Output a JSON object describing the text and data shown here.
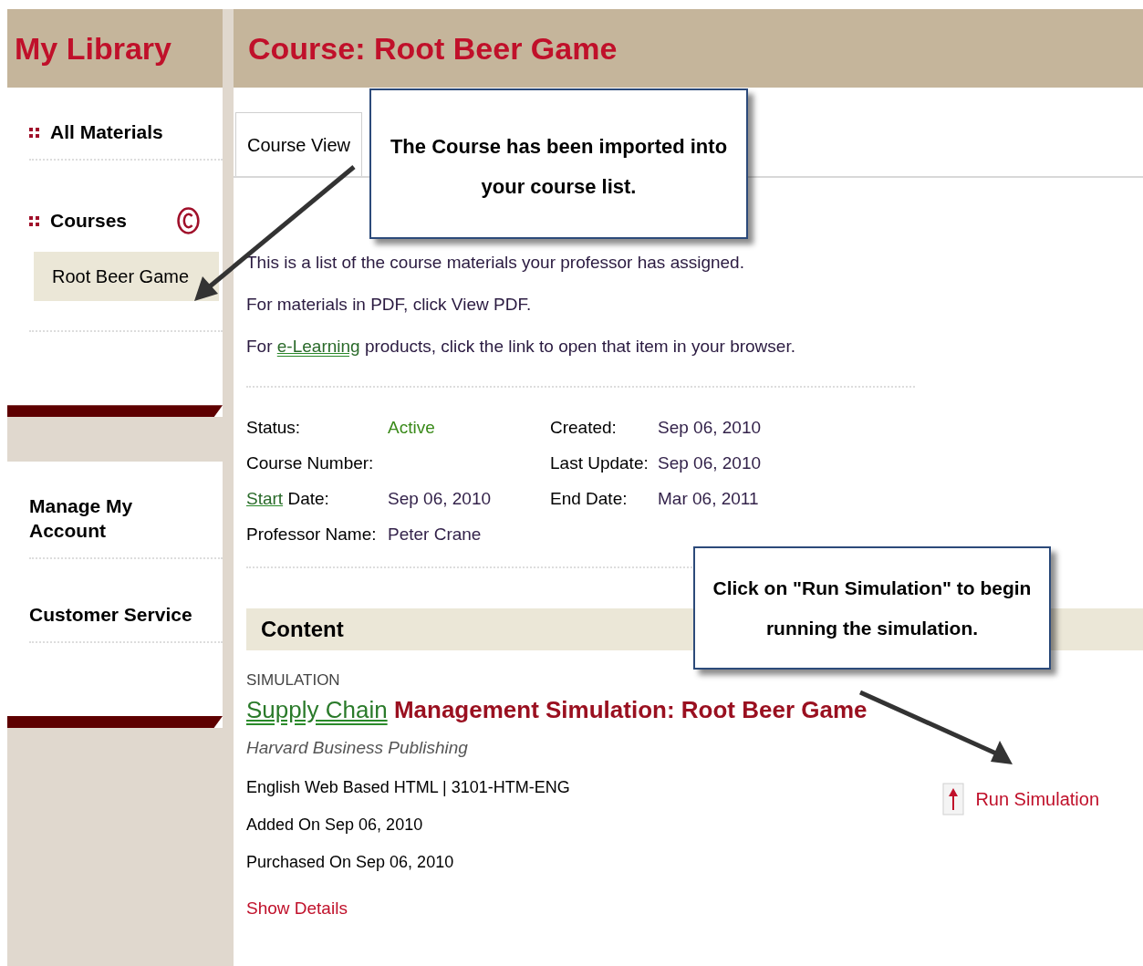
{
  "sidebar": {
    "title": "My Library",
    "blocks": [
      {
        "items": [
          {
            "label": "All Materials"
          },
          {
            "label": "Courses",
            "children": [
              {
                "label": "Root Beer Game",
                "selected": true
              }
            ]
          }
        ]
      },
      {
        "items": [
          {
            "label": "Manage My Account"
          },
          {
            "label": "Customer Service"
          }
        ]
      }
    ]
  },
  "main": {
    "title": "Course: Root Beer Game",
    "tabs": [
      {
        "label": "Course View",
        "selected": true
      }
    ],
    "intro": [
      {
        "before": "This is a list of the course materials your professor has assigned."
      },
      {
        "before": "For materials in PDF, click View PDF."
      },
      {
        "before": "For ",
        "link": "e-Learning",
        "after": " products, click the link to open that item in your browser."
      }
    ],
    "details_left": [
      {
        "label": "Status:",
        "value": "Active",
        "kind": "status"
      },
      {
        "label": "Course Number:"
      },
      {
        "label_link": "Start",
        "label": " Date:",
        "value": "Sep 06, 2010",
        "kind": "plain"
      },
      {
        "label": "Professor Name:",
        "value": "Peter Crane",
        "kind": "plain"
      }
    ],
    "details_right": [
      {
        "label": "Created:",
        "value": "Sep 06, 2010"
      },
      {
        "label": "Last Update:",
        "value": "Sep 06, 2010"
      },
      {
        "label": "End Date:",
        "value": "Mar 06, 2011"
      }
    ],
    "content": {
      "heading": "Content",
      "type": "SIMULATION",
      "title_link": "Supply Chain",
      "title_rest": " Management Simulation: Root Beer Game",
      "publisher": "Harvard Business Publishing",
      "lines": [
        "English Web Based HTML | 3101-HTM-ENG",
        "Added On Sep 06, 2010",
        "Purchased On Sep 06, 2010"
      ],
      "show_details": "Show Details",
      "run_button": "Run Simulation"
    }
  },
  "callouts": [
    {
      "text": "The Course has been imported into your course list."
    },
    {
      "text": "Click on \"Run Simulation\" to begin running the simulation."
    }
  ]
}
